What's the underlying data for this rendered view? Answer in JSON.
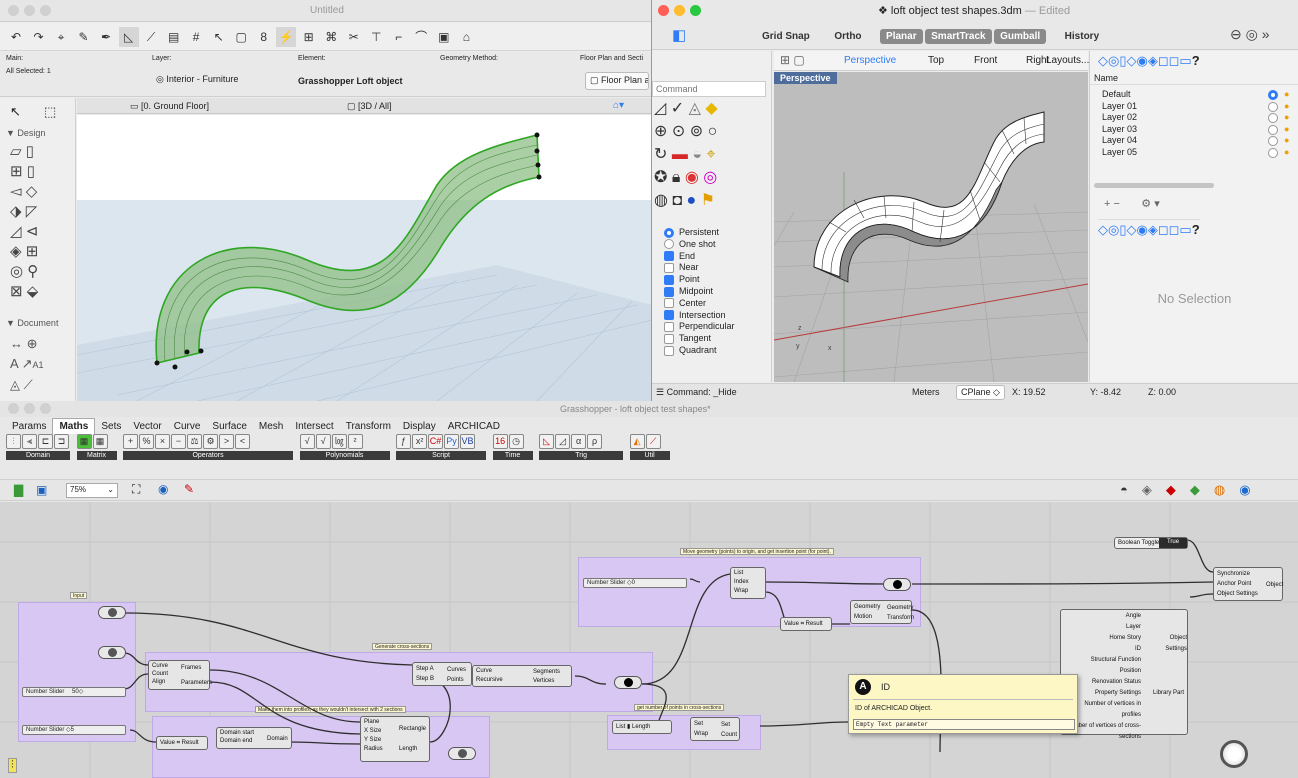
{
  "archicad": {
    "title": "Untitled",
    "info": {
      "main_label": "Main:",
      "main_value": "All Selected: 1",
      "layer_label": "Layer:",
      "layer_value": "Interior - Furniture",
      "element_label": "Element:",
      "element_value": "Grasshopper Loft object",
      "geometry_label": "Geometry Method:",
      "floorplan_label": "Floor Plan and Secti",
      "floorplan_value": "Floor Plan a"
    },
    "tab_floor": "[0. Ground Floor]",
    "tab_3d": "[3D / All]",
    "toolbox_design": "Design",
    "toolbox_document": "Document",
    "text_tool": "A1"
  },
  "rhino": {
    "title": "loft object test shapes.3dm",
    "title_suffix": "— Edited",
    "toolbar": [
      "Grid Snap",
      "Ortho",
      "Planar",
      "SmartTrack",
      "Gumball",
      "History"
    ],
    "active_toolbar": [
      "Planar",
      "SmartTrack",
      "Gumball"
    ],
    "view_tabs": [
      "Perspective",
      "Top",
      "Front",
      "Right",
      "Layouts..."
    ],
    "command_placeholder": "Command",
    "viewport_label": "Perspective",
    "snap_modes": [
      {
        "label": "Persistent",
        "type": "radio",
        "on": true
      },
      {
        "label": "One shot",
        "type": "radio",
        "on": false
      },
      {
        "label": "End",
        "type": "check",
        "on": true
      },
      {
        "label": "Near",
        "type": "check",
        "on": false
      },
      {
        "label": "Point",
        "type": "check",
        "on": true
      },
      {
        "label": "Midpoint",
        "type": "check",
        "on": true
      },
      {
        "label": "Center",
        "type": "check",
        "on": false
      },
      {
        "label": "Intersection",
        "type": "check",
        "on": true
      },
      {
        "label": "Perpendicular",
        "type": "check",
        "on": false
      },
      {
        "label": "Tangent",
        "type": "check",
        "on": false
      },
      {
        "label": "Quadrant",
        "type": "check",
        "on": false
      }
    ],
    "layers_header": "Name",
    "layers": [
      "Default",
      "Layer 01",
      "Layer 02",
      "Layer 03",
      "Layer 04",
      "Layer 05"
    ],
    "no_selection": "No Selection",
    "status": {
      "command": "Command: _Hide",
      "units": "Meters",
      "cplane": "CPlane",
      "x": "X: 19.52",
      "y": "Y: -8.42",
      "z": "Z: 0.00"
    }
  },
  "grasshopper": {
    "title": "Grasshopper - loft object test shapes*",
    "menu": [
      "Params",
      "Maths",
      "Sets",
      "Vector",
      "Curve",
      "Surface",
      "Mesh",
      "Intersect",
      "Transform",
      "Display",
      "ARCHICAD"
    ],
    "active_menu": "Maths",
    "ribbon_groups": [
      "Domain",
      "Matrix",
      "Operators",
      "Polynomials",
      "Script",
      "Time",
      "Trig",
      "Util"
    ],
    "zoom": "75%",
    "groups": {
      "input": "Input",
      "cross": "Generate cross-sections",
      "rect": "Make them into profiles, as they wouldn't intersect with 2 sections",
      "move": "Move geometry (points) to origin, and get insertion point (for point).",
      "count": "get number of points in cross-sections"
    },
    "components": {
      "number_slider": "Number Slider",
      "slider_vals": [
        "0",
        "50",
        "5"
      ],
      "frames": [
        "Curve",
        "Count",
        "Align",
        "Frames",
        "Parameters"
      ],
      "domain": [
        "Domain start",
        "Domain end",
        "Domain"
      ],
      "rectangle": [
        "Plane",
        "X Size",
        "Y Size",
        "Radius",
        "Rectangle",
        "Length"
      ],
      "loft": [
        "Step A",
        "Step B",
        "Curves",
        "Points"
      ],
      "segments": [
        "Curve",
        "Recursive",
        "Segments",
        "Vertices"
      ],
      "list": [
        "List",
        "Index",
        "Wrap",
        "Item"
      ],
      "value_result": [
        "Value",
        "Result"
      ],
      "move": [
        "Geometry",
        "Motion",
        "Geometry",
        "Transform"
      ],
      "list_length": [
        "List",
        "Length"
      ],
      "set": [
        "Set",
        "Wrap",
        "Set",
        "Count"
      ],
      "bool_toggle": [
        "Boolean Toggle",
        "True"
      ],
      "sync": [
        "Synchronize",
        "Anchor Point",
        "Object Settings",
        "Object"
      ],
      "settings_inputs": [
        "Angle",
        "Layer",
        "Home Story",
        "ID",
        "Structural Function",
        "Position",
        "Renovation Status",
        "Property Settings",
        "Number of vertices in profiles",
        "Number of vertices of cross-sections"
      ],
      "settings_outputs": [
        "Object Settings",
        "Library Part"
      ]
    },
    "tooltip": {
      "title": "ID",
      "description": "ID of ARCHICAD Object.",
      "value": "Empty Text parameter"
    }
  }
}
